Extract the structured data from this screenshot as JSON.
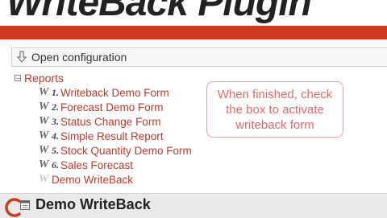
{
  "header": {
    "title": "WriteBack Plugin"
  },
  "toolbar": {
    "icon": "download-arrow-icon",
    "open_config_label": "Open configuration"
  },
  "tree": {
    "root_label": "Reports",
    "toggle_symbol": "−",
    "items": [
      {
        "prefix": "1.",
        "label": "Writeback Demo Form",
        "icon": "writeback-form-icon"
      },
      {
        "prefix": "2.",
        "label": "Forecast Demo Form",
        "icon": "writeback-form-icon"
      },
      {
        "prefix": "3.",
        "label": "Status Change Form",
        "icon": "writeback-form-icon"
      },
      {
        "prefix": "4.",
        "label": "Simple Result Report",
        "icon": "writeback-form-icon"
      },
      {
        "prefix": "5.",
        "label": "Stock Quantity Demo Form",
        "icon": "writeback-form-icon"
      },
      {
        "prefix": "6.",
        "label": "Sales Forecast",
        "icon": "writeback-form-icon"
      },
      {
        "prefix": "",
        "label": "Demo WriteBack",
        "icon": "writeback-form-icon-inactive"
      }
    ]
  },
  "callout": {
    "text": "When finished, check\nthe box to activate\nwriteback form"
  },
  "footer": {
    "title": "Demo WriteBack"
  },
  "colors": {
    "brand_red": "#cf3a1e",
    "link_red": "#c0392b",
    "callout_text": "#e26a6a"
  }
}
